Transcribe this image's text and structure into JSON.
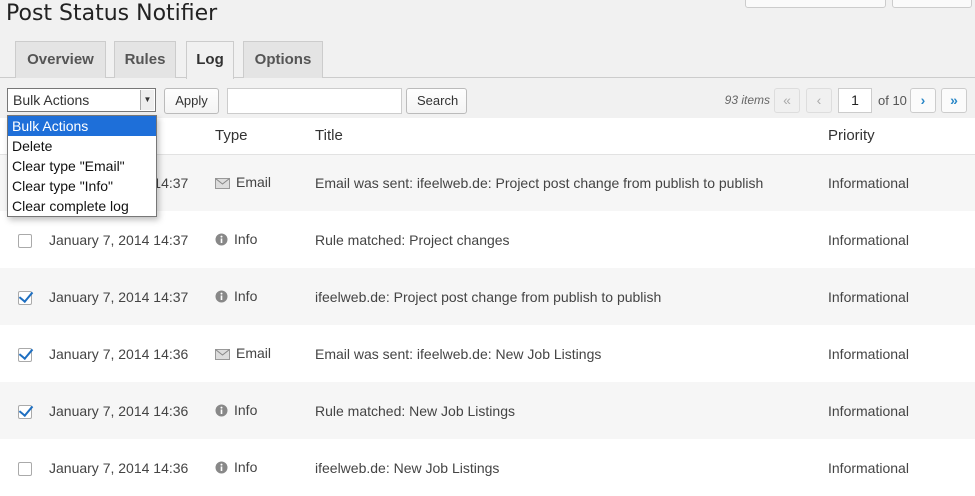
{
  "page": {
    "title": "Post Status Notifier"
  },
  "tabs": [
    {
      "label": "Overview"
    },
    {
      "label": "Rules"
    },
    {
      "label": "Log"
    },
    {
      "label": "Options"
    }
  ],
  "active_tab": "Log",
  "toolbar": {
    "bulk_selected": "Bulk Actions",
    "bulk_options": [
      "Bulk Actions",
      "Delete",
      "Clear type \"Email\"",
      "Clear type \"Info\"",
      "Clear complete log"
    ],
    "apply_label": "Apply",
    "search_value": "",
    "search_label": "Search"
  },
  "pagination": {
    "items_count": "93 items",
    "first": "«",
    "prev": "‹",
    "current_page": "1",
    "of_pages": "of 10",
    "next": "›",
    "last": "»"
  },
  "table": {
    "columns": [
      "Type",
      "Title",
      "Priority"
    ],
    "rows": [
      {
        "checked": false,
        "date": "January 7, 2014 14:37",
        "type": "Email",
        "type_icon": "envelope-icon",
        "title": "Email was sent: ifeelweb.de: Project post change from publish to publish",
        "priority": "Informational"
      },
      {
        "checked": false,
        "date": "January 7, 2014 14:37",
        "type": "Info",
        "type_icon": "info-icon",
        "title": "Rule matched: Project changes",
        "priority": "Informational"
      },
      {
        "checked": true,
        "date": "January 7, 2014 14:37",
        "type": "Info",
        "type_icon": "info-icon",
        "title": "ifeelweb.de: Project post change from publish to publish",
        "priority": "Informational"
      },
      {
        "checked": true,
        "date": "January 7, 2014 14:36",
        "type": "Email",
        "type_icon": "envelope-icon",
        "title": "Email was sent: ifeelweb.de: New Job Listings",
        "priority": "Informational"
      },
      {
        "checked": true,
        "date": "January 7, 2014 14:36",
        "type": "Info",
        "type_icon": "info-icon",
        "title": "Rule matched: New Job Listings",
        "priority": "Informational"
      },
      {
        "checked": false,
        "date": "January 7, 2014 14:36",
        "type": "Info",
        "type_icon": "info-icon",
        "title": "ifeelweb.de: New Job Listings",
        "priority": "Informational"
      }
    ]
  },
  "colors": {
    "accent": "#2a87c7",
    "dropdown_highlight": "#1e6fd9",
    "checkmark": "#1e6fc1"
  }
}
